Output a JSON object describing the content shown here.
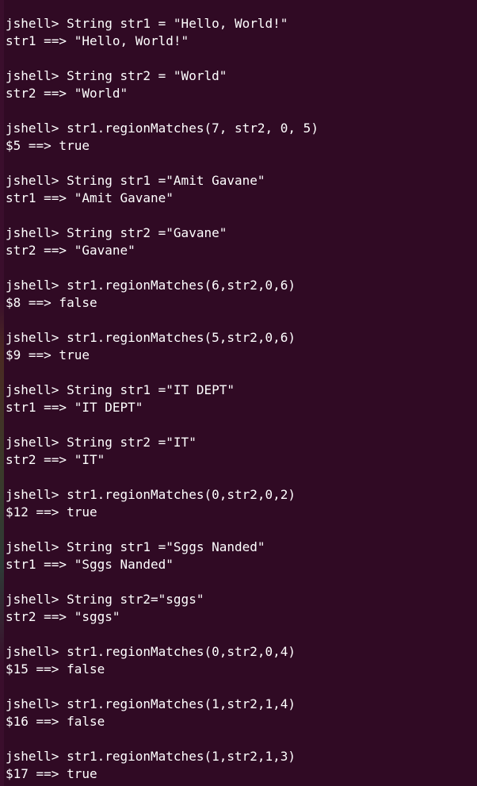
{
  "terminal": {
    "background": "#300a24",
    "foreground": "#ffffff",
    "blocks": [
      {
        "input": "jshell> String str1 = \"Hello, World!\"",
        "output": "str1 ==> \"Hello, World!\""
      },
      {
        "input": "jshell> String str2 = \"World\"",
        "output": "str2 ==> \"World\""
      },
      {
        "input": "jshell> str1.regionMatches(7, str2, 0, 5)",
        "output": "$5 ==> true"
      },
      {
        "input": "jshell> String str1 =\"Amit Gavane\"",
        "output": "str1 ==> \"Amit Gavane\""
      },
      {
        "input": "jshell> String str2 =\"Gavane\"",
        "output": "str2 ==> \"Gavane\""
      },
      {
        "input": "jshell> str1.regionMatches(6,str2,0,6)",
        "output": "$8 ==> false"
      },
      {
        "input": "jshell> str1.regionMatches(5,str2,0,6)",
        "output": "$9 ==> true"
      },
      {
        "input": "jshell> String str1 =\"IT DEPT\"",
        "output": "str1 ==> \"IT DEPT\""
      },
      {
        "input": "jshell> String str2 =\"IT\"",
        "output": "str2 ==> \"IT\""
      },
      {
        "input": "jshell> str1.regionMatches(0,str2,0,2)",
        "output": "$12 ==> true"
      },
      {
        "input": "jshell> String str1 =\"Sggs Nanded\"",
        "output": "str1 ==> \"Sggs Nanded\""
      },
      {
        "input": "jshell> String str2=\"sggs\"",
        "output": "str2 ==> \"sggs\""
      },
      {
        "input": "jshell> str1.regionMatches(0,str2,0,4)",
        "output": "$15 ==> false"
      },
      {
        "input": "jshell> str1.regionMatches(1,str2,1,4)",
        "output": "$16 ==> false"
      },
      {
        "input": "jshell> str1.regionMatches(1,str2,1,3)",
        "output": "$17 ==> true"
      }
    ]
  }
}
